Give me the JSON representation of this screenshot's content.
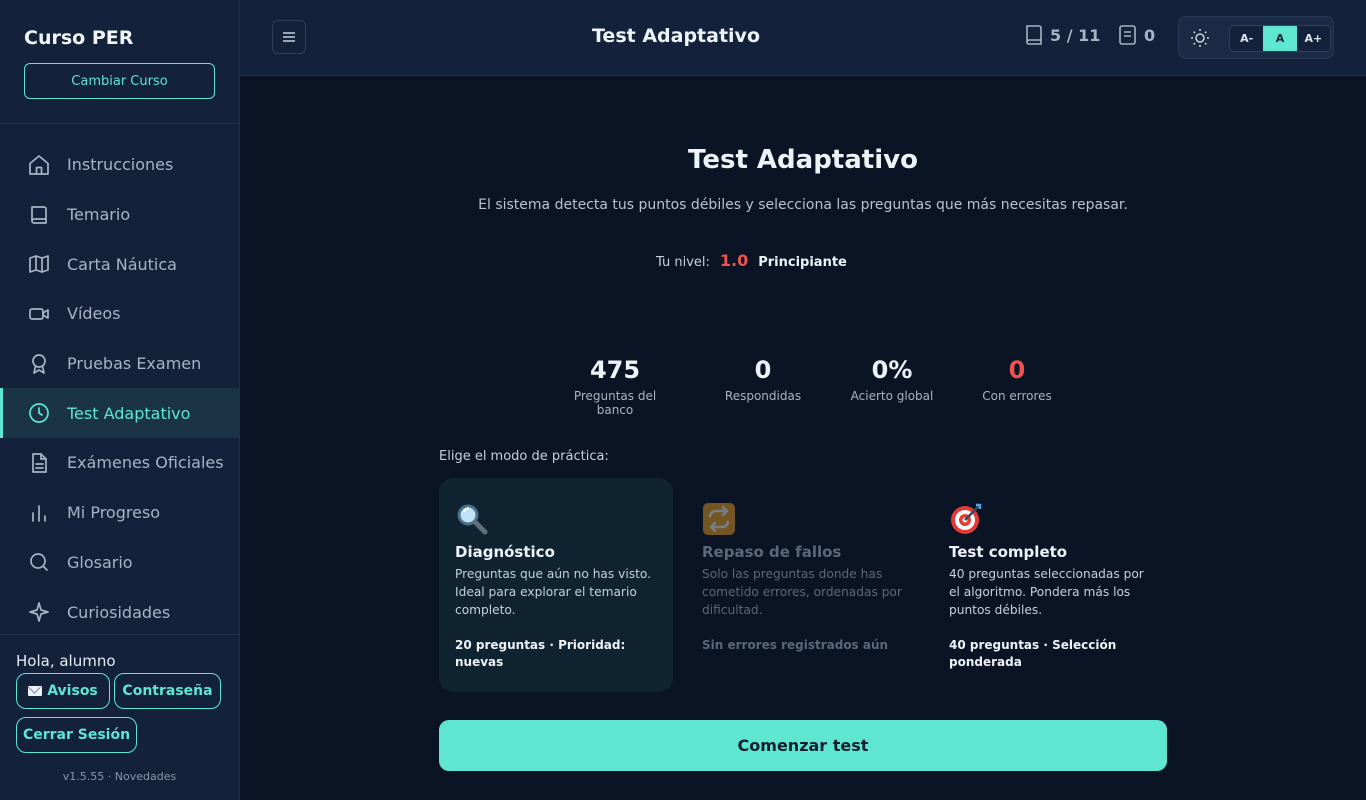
{
  "sidebar": {
    "brand": "Curso PER",
    "change_course": "Cambiar Curso",
    "items": [
      {
        "label": "Instrucciones",
        "icon": "home-icon"
      },
      {
        "label": "Temario",
        "icon": "book-icon"
      },
      {
        "label": "Carta Náutica",
        "icon": "map-icon"
      },
      {
        "label": "Vídeos",
        "icon": "video-icon"
      },
      {
        "label": "Pruebas Examen",
        "icon": "award-icon"
      },
      {
        "label": "Test Adaptativo",
        "icon": "clock-icon",
        "active": true
      },
      {
        "label": "Exámenes Oficiales",
        "icon": "document-icon"
      },
      {
        "label": "Mi Progreso",
        "icon": "bar-chart-icon"
      },
      {
        "label": "Glosario",
        "icon": "search-icon"
      },
      {
        "label": "Curiosidades",
        "icon": "sparkle-icon"
      }
    ],
    "greeting": "Hola, alumno",
    "avisos": "Avisos",
    "password": "Contraseña",
    "logout": "Cerrar Sesión",
    "version": "v1.5.55 · Novedades"
  },
  "topbar": {
    "title": "Test Adaptativo",
    "lessons": "5 / 11",
    "docs": "0",
    "font_small": "A-",
    "font_normal": "A",
    "font_large": "A+"
  },
  "main": {
    "title": "Test Adaptativo",
    "subtitle": "El sistema detecta tus puntos débiles y selecciona las preguntas que más necesitas repasar.",
    "level_label": "Tu nivel:",
    "level_value": "1.0",
    "level_name": "Principiante",
    "stats": [
      {
        "value": "475",
        "label": "Preguntas del banco"
      },
      {
        "value": "0",
        "label": "Respondidas"
      },
      {
        "value": "0%",
        "label": "Acierto global"
      },
      {
        "value": "0",
        "label": "Con errores"
      }
    ],
    "mode_label": "Elige el modo de práctica:",
    "modes": [
      {
        "icon": "magnifier-icon",
        "title": "Diagnóstico",
        "desc": "Preguntas que aún no has visto. Ideal para explorar el temario completo.",
        "foot": "20 preguntas · Prioridad: nuevas",
        "selected": true
      },
      {
        "icon": "repeat-icon",
        "title": "Repaso de fallos",
        "desc": "Solo las preguntas donde has cometido errores, ordenadas por dificultad.",
        "foot": "Sin errores registrados aún",
        "disabled": true
      },
      {
        "icon": "target-icon",
        "title": "Test completo",
        "desc": "40 preguntas seleccionadas por el algoritmo. Pondera más los puntos débiles.",
        "foot": "40 preguntas · Selección ponderada"
      }
    ],
    "start": "Comenzar test"
  },
  "colors": {
    "accent": "#5ee6d3",
    "danger": "#ef5350",
    "background": "#0a1424",
    "panel": "#13213b"
  }
}
